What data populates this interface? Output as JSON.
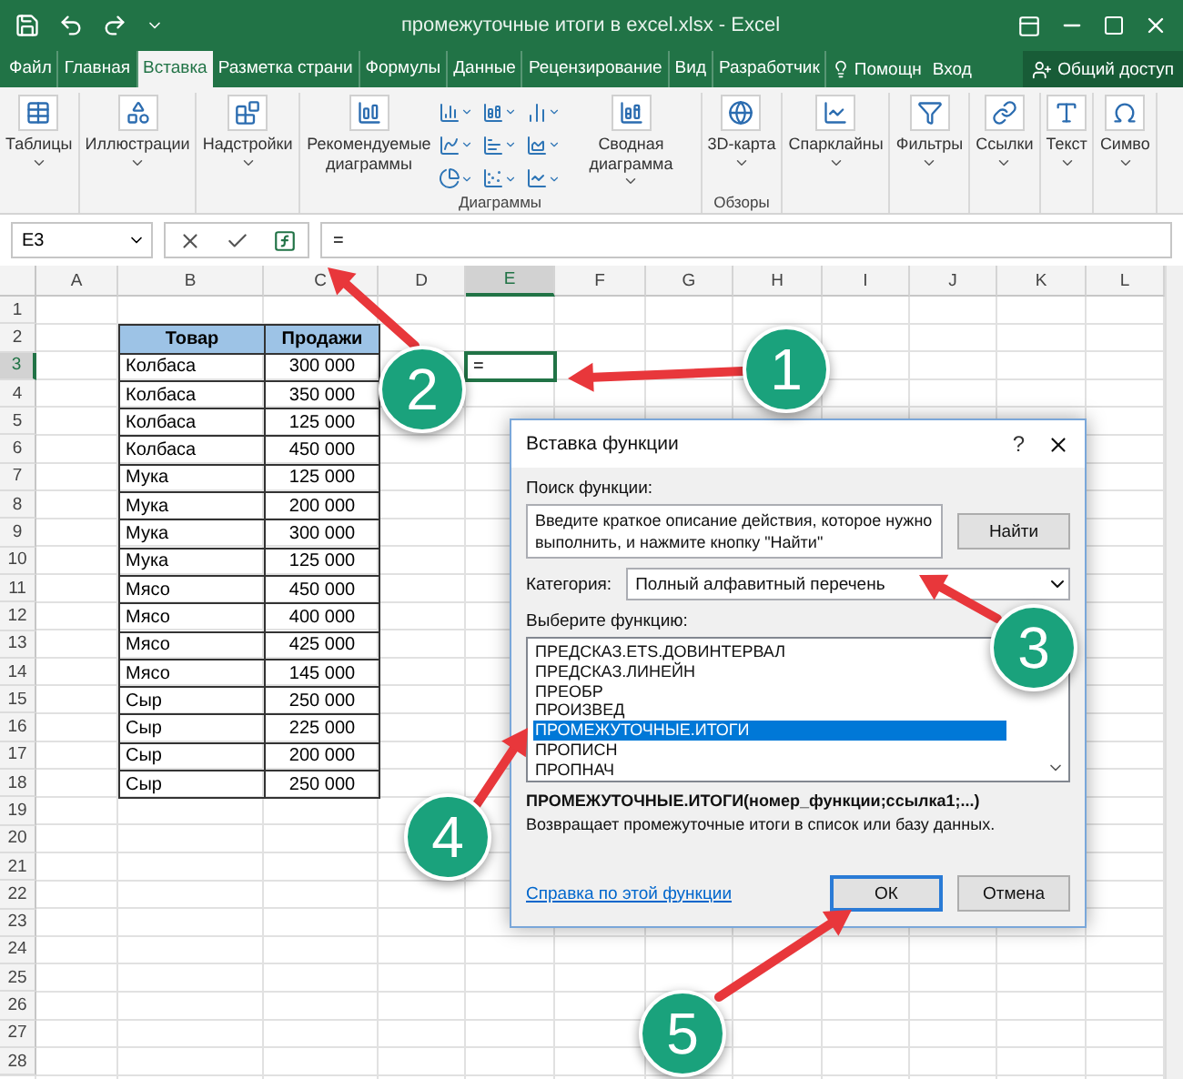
{
  "window": {
    "title": "промежуточные итоги в excel.xlsx - Excel"
  },
  "tabs": [
    {
      "label": "Файл",
      "selected": false
    },
    {
      "label": "Главная",
      "selected": false
    },
    {
      "label": "Вставка",
      "selected": true
    },
    {
      "label": "Разметка страни",
      "selected": false
    },
    {
      "label": "Формулы",
      "selected": false
    },
    {
      "label": "Данные",
      "selected": false
    },
    {
      "label": "Рецензирование",
      "selected": false
    },
    {
      "label": "Вид",
      "selected": false
    },
    {
      "label": "Разработчик",
      "selected": false
    }
  ],
  "tell_me": "Помощн",
  "sign_in": "Вход",
  "share": "Общий доступ",
  "ribbon": {
    "groups": [
      {
        "items": [
          {
            "kind": "large",
            "label": "Таблицы",
            "dropdown": true
          }
        ]
      },
      {
        "items": [
          {
            "kind": "large",
            "label": "Иллюстрации",
            "dropdown": true
          }
        ]
      },
      {
        "items": [
          {
            "kind": "large",
            "label": "Надстройки",
            "dropdown": true
          }
        ]
      },
      {
        "label": "Диаграммы",
        "items": [
          {
            "kind": "large",
            "label": "Рекомендуемые диаграммы",
            "dropdown": false
          },
          {
            "kind": "gallery"
          },
          {
            "kind": "large",
            "label": "Сводная диаграмма",
            "dropdown": true
          }
        ]
      },
      {
        "label": "Обзоры",
        "items": [
          {
            "kind": "large",
            "label": "3D-карта",
            "dropdown": true
          }
        ]
      },
      {
        "items": [
          {
            "kind": "large",
            "label": "Спарклайны",
            "dropdown": true
          }
        ]
      },
      {
        "items": [
          {
            "kind": "large",
            "label": "Фильтры",
            "dropdown": true
          }
        ]
      },
      {
        "items": [
          {
            "kind": "large",
            "label": "Ссылки",
            "dropdown": true
          }
        ]
      },
      {
        "items": [
          {
            "kind": "large",
            "label": "Текст",
            "dropdown": true
          }
        ]
      },
      {
        "items": [
          {
            "kind": "large",
            "label": "Симво",
            "dropdown": true
          }
        ]
      }
    ]
  },
  "formula_bar": {
    "name_box": "E3",
    "formula": "="
  },
  "sheet": {
    "columns": [
      {
        "label": "A",
        "selected": false
      },
      {
        "label": "B",
        "selected": false
      },
      {
        "label": "C",
        "selected": false
      },
      {
        "label": "D",
        "selected": false
      },
      {
        "label": "E",
        "selected": true
      },
      {
        "label": "F",
        "selected": false
      },
      {
        "label": "G",
        "selected": false
      },
      {
        "label": "H",
        "selected": false
      },
      {
        "label": "I",
        "selected": false
      },
      {
        "label": "J",
        "selected": false
      },
      {
        "label": "K",
        "selected": false
      },
      {
        "label": "L",
        "selected": false
      }
    ],
    "rows": [
      {
        "label": "1",
        "selected": false
      },
      {
        "label": "2",
        "selected": false
      },
      {
        "label": "3",
        "selected": true
      },
      {
        "label": "4",
        "selected": false
      },
      {
        "label": "5",
        "selected": false
      },
      {
        "label": "6",
        "selected": false
      },
      {
        "label": "7",
        "selected": false
      },
      {
        "label": "8",
        "selected": false
      },
      {
        "label": "9",
        "selected": false
      },
      {
        "label": "10",
        "selected": false
      },
      {
        "label": "11",
        "selected": false
      },
      {
        "label": "12",
        "selected": false
      },
      {
        "label": "13",
        "selected": false
      },
      {
        "label": "14",
        "selected": false
      },
      {
        "label": "15",
        "selected": false
      },
      {
        "label": "16",
        "selected": false
      },
      {
        "label": "17",
        "selected": false
      },
      {
        "label": "18",
        "selected": false
      },
      {
        "label": "19",
        "selected": false
      },
      {
        "label": "20",
        "selected": false
      },
      {
        "label": "21",
        "selected": false
      },
      {
        "label": "22",
        "selected": false
      },
      {
        "label": "23",
        "selected": false
      },
      {
        "label": "24",
        "selected": false
      },
      {
        "label": "25",
        "selected": false
      },
      {
        "label": "26",
        "selected": false
      },
      {
        "label": "27",
        "selected": false
      },
      {
        "label": "28",
        "selected": false
      }
    ],
    "table": {
      "columns": [
        "Товар",
        "Продажи"
      ],
      "rows": [
        [
          "Колбаса",
          "300 000"
        ],
        [
          "Колбаса",
          "350 000"
        ],
        [
          "Колбаса",
          "125 000"
        ],
        [
          "Колбаса",
          "450 000"
        ],
        [
          "Мука",
          "125 000"
        ],
        [
          "Мука",
          "200 000"
        ],
        [
          "Мука",
          "300 000"
        ],
        [
          "Мука",
          "125 000"
        ],
        [
          "Мясо",
          "450 000"
        ],
        [
          "Мясо",
          "400 000"
        ],
        [
          "Мясо",
          "425 000"
        ],
        [
          "Мясо",
          "145 000"
        ],
        [
          "Сыр",
          "250 000"
        ],
        [
          "Сыр",
          "225 000"
        ],
        [
          "Сыр",
          "200 000"
        ],
        [
          "Сыр",
          "250 000"
        ]
      ]
    },
    "active_cell": {
      "value": "="
    }
  },
  "dialog": {
    "title": "Вставка функции",
    "help": "?",
    "search_label": "Поиск функции:",
    "search_value": "Введите краткое описание действия, которое нужно выполнить, и нажмите кнопку \"Найти\"",
    "find_button": "Найти",
    "category_label": "Категория:",
    "category_value": "Полный алфавитный перечень",
    "list_label": "Выберите функцию:",
    "functions": [
      {
        "label": "ПРЕДСКАЗ.ETS.ДОВИНТЕРВАЛ",
        "selected": false
      },
      {
        "label": "ПРЕДСКАЗ.ЛИНЕЙН",
        "selected": false
      },
      {
        "label": "ПРЕОБР",
        "selected": false
      },
      {
        "label": "ПРОИЗВЕД",
        "selected": false
      },
      {
        "label": "ПРОМЕЖУТОЧНЫЕ.ИТОГИ",
        "selected": true
      },
      {
        "label": "ПРОПИСН",
        "selected": false
      },
      {
        "label": "ПРОПНАЧ",
        "selected": false
      }
    ],
    "signature": "ПРОМЕЖУТОЧНЫЕ.ИТОГИ(номер_функции;ссылка1;...)",
    "description": "Возвращает промежуточные итоги в список или базу данных.",
    "help_link": "Справка по этой функции",
    "buttons": [
      {
        "label": "ОК",
        "kind": "default"
      },
      {
        "label": "Отмена",
        "kind": "normal"
      }
    ]
  },
  "annotations": [
    {
      "label": "1"
    },
    {
      "label": "2"
    },
    {
      "label": "3"
    },
    {
      "label": "4"
    },
    {
      "label": "5"
    }
  ]
}
